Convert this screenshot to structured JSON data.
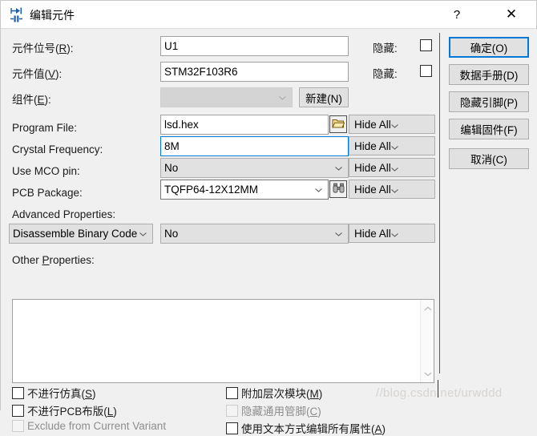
{
  "window": {
    "title": "编辑元件",
    "icon": "component-editor-icon",
    "help_label": "?",
    "close_label": "✕"
  },
  "fields": [
    {
      "label_prefix": "元件位号(",
      "mnemonic": "R",
      "label_suffix": "):",
      "value": "U1",
      "hidden_label": "隐藏:"
    },
    {
      "label_prefix": "元件值(",
      "mnemonic": "V",
      "label_suffix": "):",
      "value": "STM32F103R6",
      "hidden_label": "隐藏:"
    },
    {
      "label_prefix": "组件(",
      "mnemonic": "E",
      "label_suffix": "):",
      "value": "",
      "button_label": "新建(N)"
    }
  ],
  "properties": [
    {
      "label": "Program File:",
      "value": "lsd.hex",
      "icon": "folder-icon",
      "hide": "Hide All"
    },
    {
      "label": "Crystal Frequency:",
      "value": "8M",
      "hide": "Hide All"
    },
    {
      "label": "Use MCO pin:",
      "value": "No",
      "hide": "Hide All"
    },
    {
      "label": "PCB Package:",
      "value": "TQFP64-12X12MM",
      "icon": "binoculars-icon",
      "hide": "Hide All"
    }
  ],
  "advanced": {
    "label": "Advanced Properties:",
    "key": "Disassemble Binary Code",
    "value": "No",
    "hide": "Hide All"
  },
  "other_properties": {
    "label_prefix": "Other ",
    "mnemonic": "P",
    "label_suffix": "roperties:",
    "value": ""
  },
  "checkboxes": [
    {
      "prefix": "不进行仿真(",
      "mnemonic": "S",
      "suffix": ")",
      "checked": false,
      "disabled": false
    },
    {
      "prefix": "不进行PCB布版(",
      "mnemonic": "L",
      "suffix": ")",
      "checked": false,
      "disabled": false
    },
    {
      "prefix": "Exclude from Current Variant",
      "mnemonic": "",
      "suffix": "",
      "checked": false,
      "disabled": true
    },
    {
      "prefix": "附加层次模块(",
      "mnemonic": "M",
      "suffix": ")",
      "checked": false,
      "disabled": false
    },
    {
      "prefix": "隐藏通用管脚(",
      "mnemonic": "C",
      "suffix": ")",
      "checked": false,
      "disabled": true
    },
    {
      "prefix": "使用文本方式编辑所有属性(",
      "mnemonic": "A",
      "suffix": ")",
      "checked": false,
      "disabled": false
    }
  ],
  "buttons": [
    {
      "label": "确定(O)",
      "default": true
    },
    {
      "label": "数据手册(D)",
      "default": false
    },
    {
      "label": "隐藏引脚(P)",
      "default": false
    },
    {
      "label": "编辑固件(F)",
      "default": false
    },
    {
      "label": "取消(C)",
      "default": false
    }
  ],
  "watermark": "//blog.csdn.net/urwddd",
  "colors": {
    "accent": "#0078d7",
    "dialog_bg": "#f0f0f0",
    "control_bg": "#e1e1e1",
    "field_bg": "#ffffff"
  }
}
